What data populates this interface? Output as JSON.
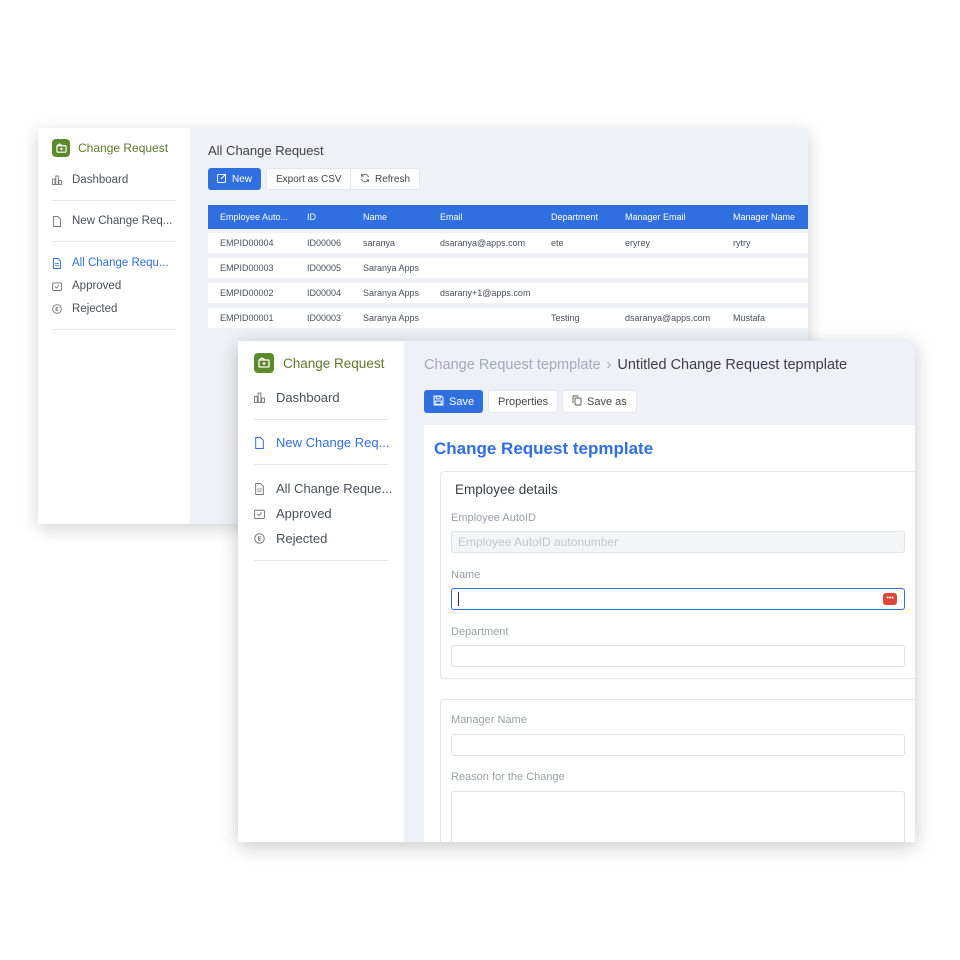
{
  "app": {
    "brand_name": "Change Request",
    "brand_color": "#5c8a2a",
    "accent_color": "#2f6fe0"
  },
  "back_window": {
    "sidebar": {
      "dashboard": "Dashboard",
      "new_change_request": "New Change Req...",
      "all_change_request": "All Change Requ...",
      "approved": "Approved",
      "rejected": "Rejected"
    },
    "title": "All Change Request",
    "toolbar": {
      "new_label": "New",
      "export_label": "Export as CSV",
      "refresh_label": "Refresh"
    },
    "table": {
      "columns": [
        "Employee Auto...",
        "ID",
        "Name",
        "Email",
        "Department",
        "Manager Email",
        "Manager Name"
      ],
      "rows": [
        [
          "EMPID00004",
          "ID00006",
          "saranya",
          "dsaranya@apps.com",
          "ete",
          "eryrey",
          "rytry"
        ],
        [
          "EMPID00003",
          "ID00005",
          "Saranya Apps",
          "",
          "",
          "",
          ""
        ],
        [
          "EMPID00002",
          "ID00004",
          "Saranya Apps",
          "dsarany+1@apps.com",
          "",
          "",
          ""
        ],
        [
          "EMPID00001",
          "ID00003",
          "Saranya Apps",
          "",
          "Testing",
          "dsaranya@apps.com",
          "Mustafa"
        ]
      ]
    }
  },
  "front_window": {
    "sidebar": {
      "dashboard": "Dashboard",
      "new_change_request": "New Change Req...",
      "all_change_request": "All Change Reque...",
      "approved": "Approved",
      "rejected": "Rejected"
    },
    "breadcrumb": {
      "parent": "Change Request tepmplate",
      "current": "Untitled Change Request tepmplate"
    },
    "toolbar": {
      "save_label": "Save",
      "properties_label": "Properties",
      "save_as_label": "Save as"
    },
    "form": {
      "title": "Change Request tepmplate",
      "section1_title": "Employee details",
      "employee_autoid_label": "Employee AutoID",
      "employee_autoid_placeholder": "Employee AutoID autonumber",
      "name_label": "Name",
      "name_value": "",
      "department_label": "Department",
      "department_value": "",
      "manager_name_label": "Manager Name",
      "manager_name_value": "",
      "reason_label": "Reason for the Change",
      "reason_value": ""
    }
  }
}
